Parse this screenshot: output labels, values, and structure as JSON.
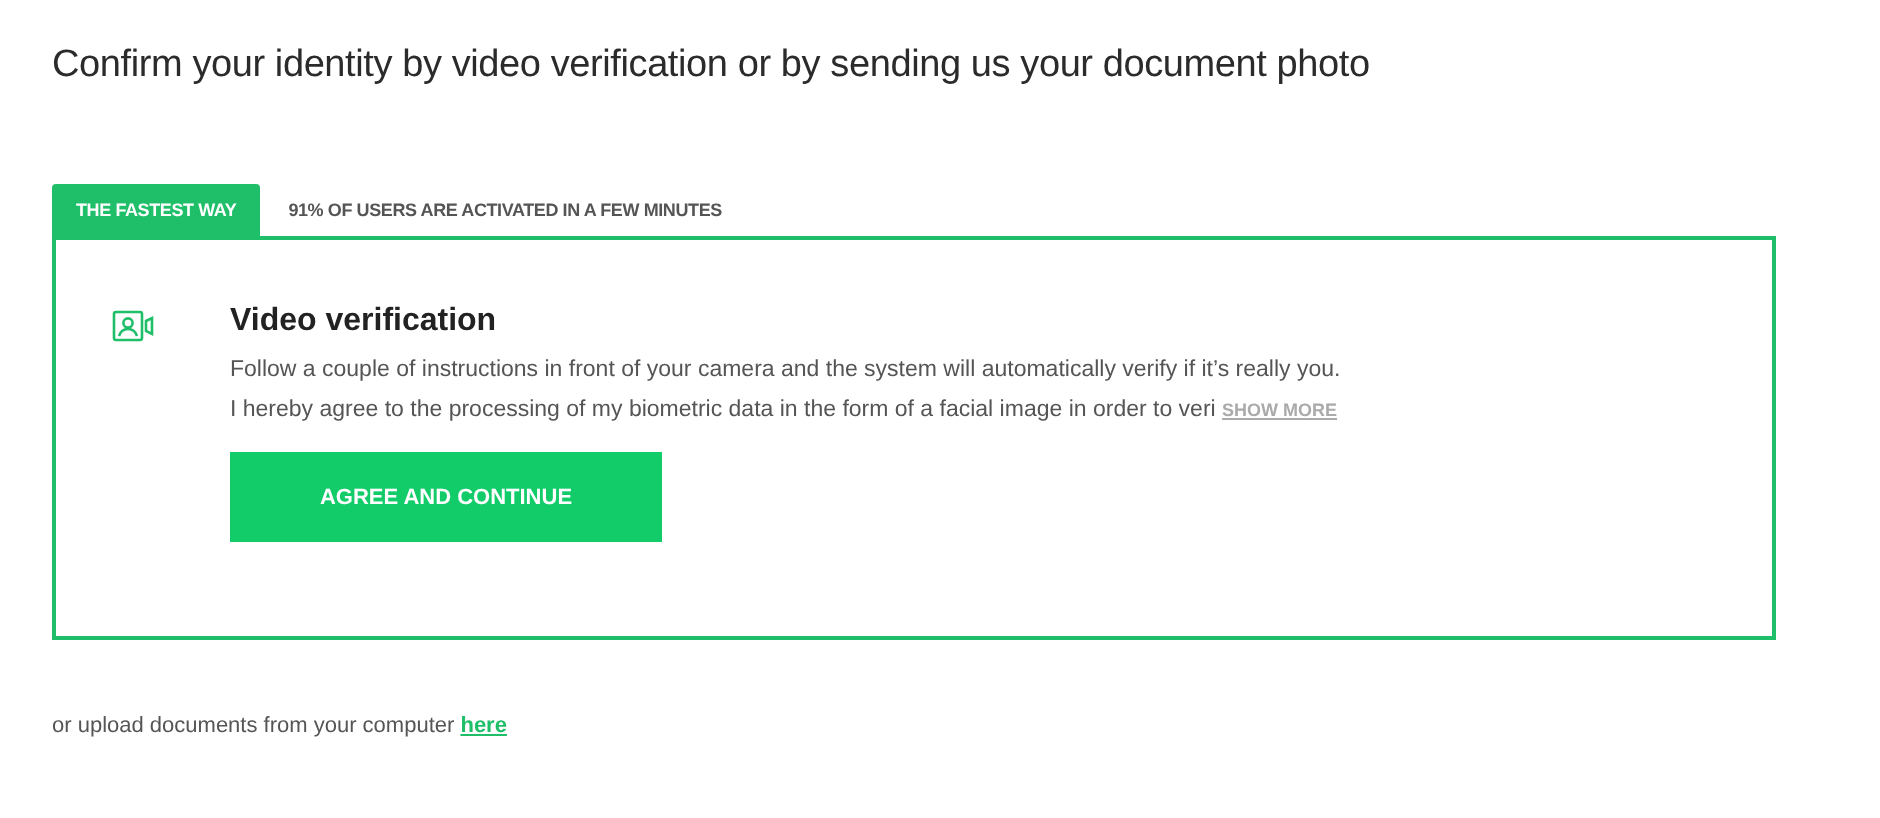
{
  "heading": "Confirm your identity by video verification or by sending us your document photo",
  "tabs": [
    {
      "label": "THE FASTEST WAY",
      "selected": true
    },
    {
      "label": "91% OF USERS ARE ACTIVATED IN A FEW MINUTES",
      "selected": false
    }
  ],
  "option": {
    "title": "Video verification",
    "description": "Follow a couple of instructions in front of your camera and the system will automatically verify if it’s really you.",
    "consent": "I hereby agree to the processing of my biometric data in the form of a facial image in order to veri",
    "show_more": "SHOW MORE",
    "button": "AGREE AND CONTINUE"
  },
  "footer": {
    "text": "or upload documents from your computer",
    "link": "here"
  }
}
